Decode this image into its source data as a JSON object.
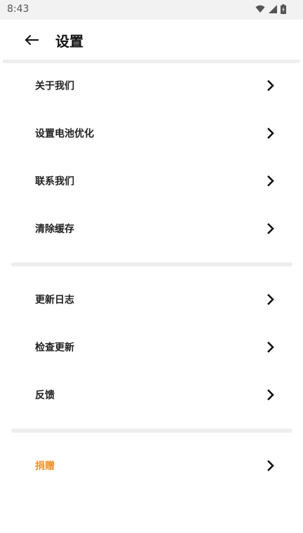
{
  "status_bar": {
    "time": "8:43"
  },
  "toolbar": {
    "title": "设置"
  },
  "groups": [
    {
      "items": [
        {
          "label": "关于我们"
        },
        {
          "label": "设置电池优化"
        },
        {
          "label": "联系我们"
        },
        {
          "label": "清除缓存"
        }
      ]
    },
    {
      "items": [
        {
          "label": "更新日志"
        },
        {
          "label": "检查更新"
        },
        {
          "label": "反馈"
        }
      ]
    },
    {
      "items": [
        {
          "label": "捐赠"
        }
      ]
    }
  ],
  "colors": {
    "accent": "#f0922a",
    "divider": "#eeeeee",
    "text": "#222222"
  }
}
